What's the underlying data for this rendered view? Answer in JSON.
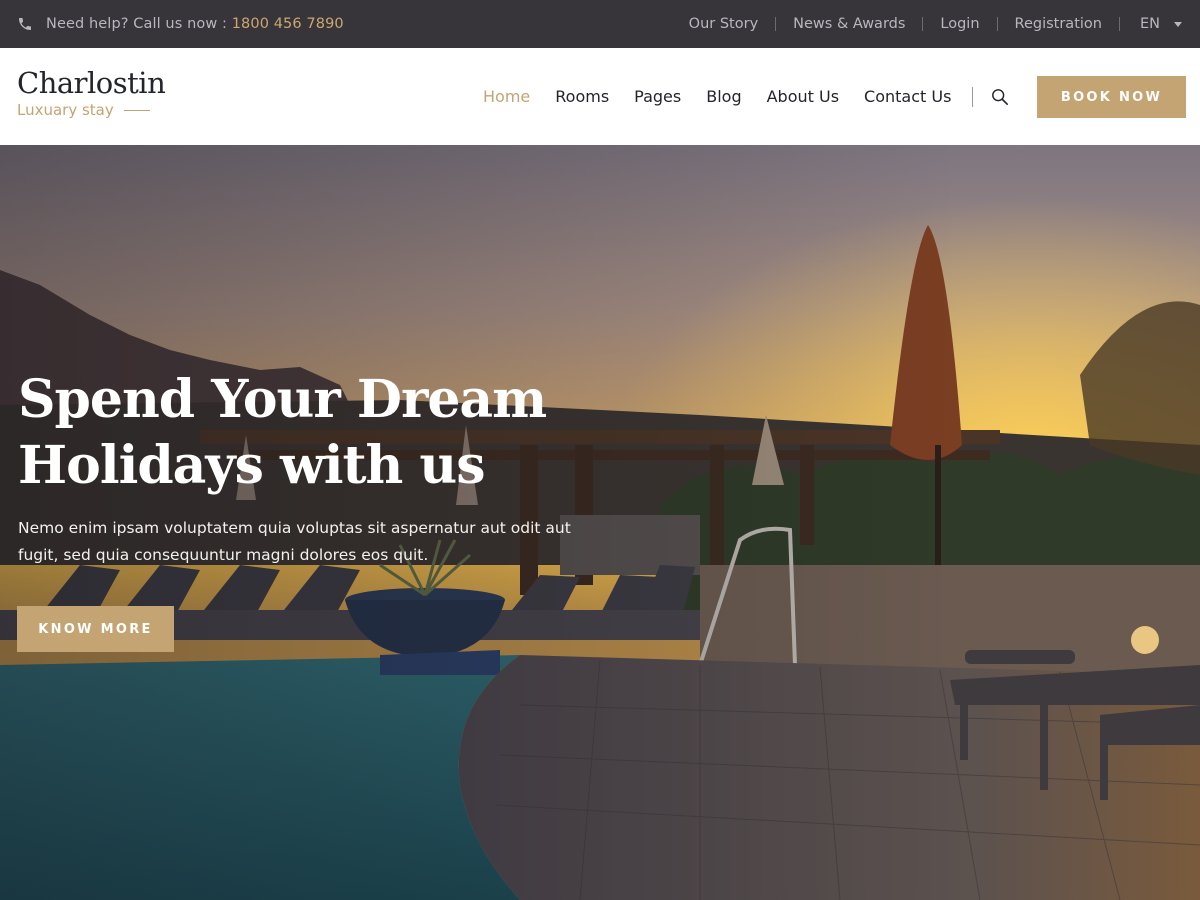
{
  "topbar": {
    "help_text": "Need help? Call us now :",
    "phone": "1800 456 7890",
    "links": [
      "Our Story",
      "News & Awards",
      "Login",
      "Registration"
    ],
    "language": "EN"
  },
  "header": {
    "brand": "Charlostin",
    "tagline": "Luxuary stay",
    "nav": [
      "Home",
      "Rooms",
      "Pages",
      "Blog",
      "About Us",
      "Contact Us"
    ],
    "active_nav": "Home",
    "book_label": "BOOK NOW"
  },
  "hero": {
    "title_line1": "Spend Your Dream",
    "title_line2": "Holidays with us",
    "description": "Nemo enim ipsam voluptatem quia voluptas sit aspernatur aut odit aut fugit, sed quia consequuntur magni dolores eos quit.",
    "cta_label": "KNOW MORE"
  },
  "colors": {
    "accent": "#c4a473",
    "topbar_bg": "#37343a",
    "header_bg": "#ffffff",
    "text_dark": "#23252b"
  },
  "icons": {
    "phone": "phone-icon",
    "search": "search-icon",
    "caret": "chevron-down-icon"
  }
}
